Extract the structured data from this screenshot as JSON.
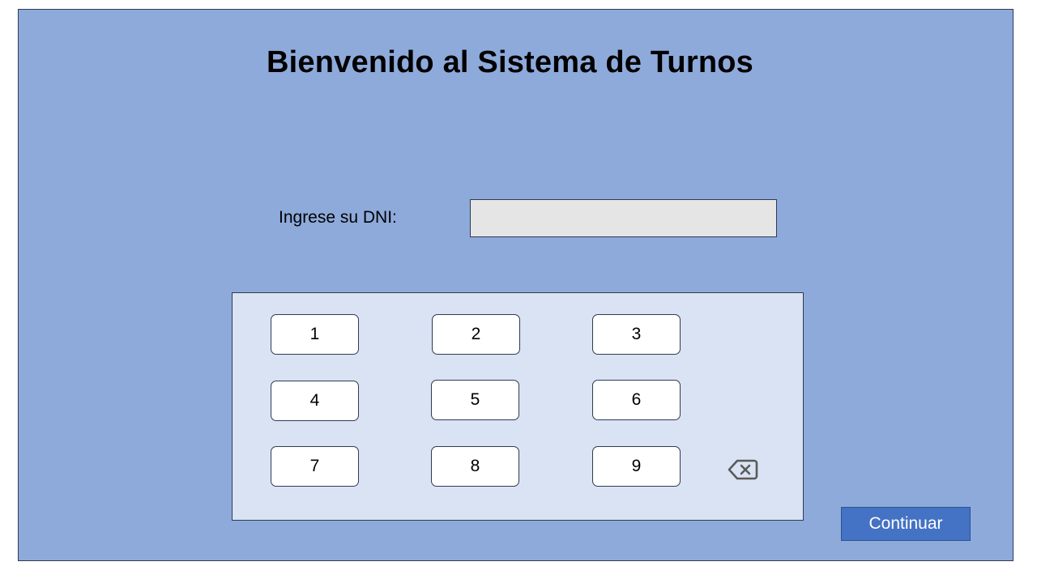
{
  "title": "Bienvenido al Sistema de Turnos",
  "dni": {
    "label": "Ingrese su DNI:",
    "value": ""
  },
  "keypad": {
    "keys": [
      "1",
      "2",
      "3",
      "4",
      "5",
      "6",
      "7",
      "8",
      "9"
    ],
    "backspace_icon": "backspace-icon"
  },
  "continue_label": "Continuar",
  "colors": {
    "background": "#8eaadb",
    "keypad_panel": "#dae3f3",
    "input": "#e5e5e5",
    "primary_button": "#4472c4"
  }
}
